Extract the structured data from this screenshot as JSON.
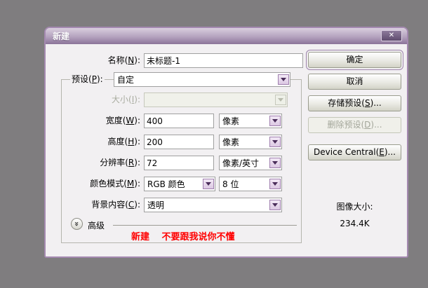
{
  "window": {
    "title": "新建",
    "close_glyph": "✕"
  },
  "fields": {
    "name": {
      "label_pre": "名称(",
      "label_key": "N",
      "label_post": "):",
      "value": "未标题-1"
    },
    "preset": {
      "label_pre": "预设(",
      "label_key": "P",
      "label_post": "):",
      "value": "自定"
    },
    "size": {
      "label_pre": "大小(",
      "label_key": "I",
      "label_post": "):",
      "value": ""
    },
    "width": {
      "label_pre": "宽度(",
      "label_key": "W",
      "label_post": "):",
      "value": "400",
      "unit": "像素"
    },
    "height": {
      "label_pre": "高度(",
      "label_key": "H",
      "label_post": "):",
      "value": "200",
      "unit": "像素"
    },
    "resolution": {
      "label_pre": "分辨率(",
      "label_key": "R",
      "label_post": "):",
      "value": "72",
      "unit": "像素/英寸"
    },
    "color_mode": {
      "label_pre": "颜色模式(",
      "label_key": "M",
      "label_post": "):",
      "value": "RGB 颜色",
      "depth": "8 位"
    },
    "background": {
      "label_pre": "背景内容(",
      "label_key": "C",
      "label_post": "):",
      "value": "透明"
    }
  },
  "advanced": {
    "label": "高级",
    "chevron_glyph": "»"
  },
  "annotation": {
    "text": "新建　 不要跟我说你不懂"
  },
  "buttons": {
    "ok": "确定",
    "cancel": "取消",
    "save_preset_pre": "存储预设(",
    "save_preset_key": "S",
    "save_preset_post": ")...",
    "delete_preset_pre": "删除预设(",
    "delete_preset_key": "D",
    "delete_preset_post": ")...",
    "device_central_pre": "Device Central(",
    "device_central_key": "E",
    "device_central_post": ")..."
  },
  "info": {
    "image_size_label": "图像大小:",
    "image_size_value": "234.4K"
  },
  "colors": {
    "desktop_background": "#7f7d7f",
    "dialog_border": "#a489b0",
    "titlebar_top": "#d9cede",
    "titlebar_bottom": "#8b7499",
    "dialog_body": "#f2f0f2",
    "combo_arrow_bg": "#e7d4ed",
    "combo_arrow_border": "#9f7fae",
    "annotation_red": "#ff0000"
  }
}
